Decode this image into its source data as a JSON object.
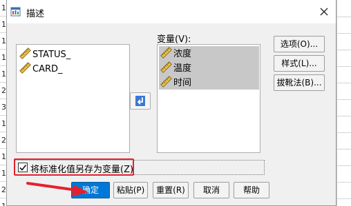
{
  "bg_sheet": {
    "row_numbers": [
      "1",
      "1",
      "1",
      "1",
      "1",
      "2",
      "3",
      "1",
      "2",
      "1",
      "1",
      "2",
      "1"
    ]
  },
  "dialog": {
    "title": "描述",
    "source_items": [
      {
        "label": "STATUS_",
        "icon": "ruler-icon"
      },
      {
        "label": "CARD_",
        "icon": "ruler-icon"
      }
    ],
    "variables_label": "变量(V):",
    "target_items": [
      {
        "label": "浓度",
        "icon": "ruler-icon"
      },
      {
        "label": "温度",
        "icon": "ruler-icon"
      },
      {
        "label": "时间",
        "icon": "ruler-icon"
      }
    ],
    "side_buttons": {
      "options": "选项(O)...",
      "style": "样式(L)...",
      "bootstrap": "拔靴法(B)..."
    },
    "checkbox": {
      "label": "将标准化值另存为变量(Z)",
      "checked": true
    },
    "bottom_buttons": {
      "ok": "确定",
      "paste": "粘贴(P)",
      "reset": "重置(R)",
      "cancel": "取消",
      "help": "帮助"
    }
  },
  "colors": {
    "default_button": "#0078d7",
    "annotation_red": "#e5202d",
    "selection_bg": "#c8c8c8"
  }
}
